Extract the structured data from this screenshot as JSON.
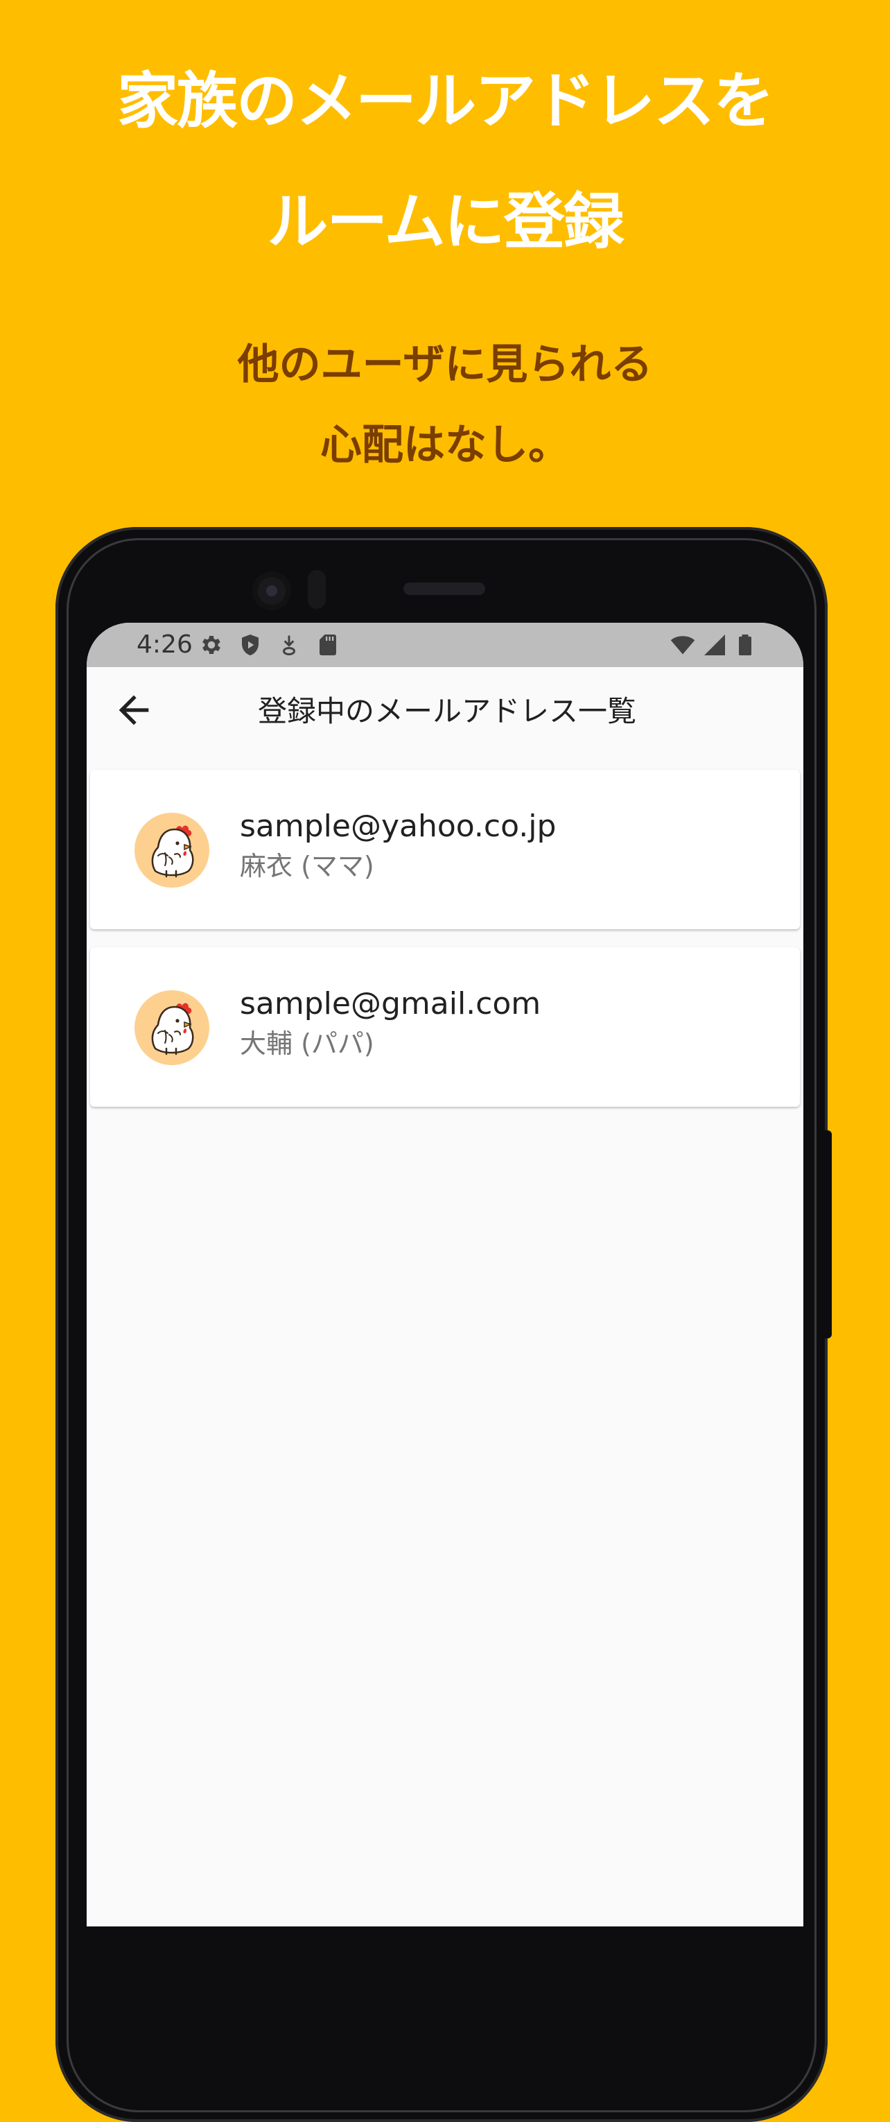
{
  "promo": {
    "headline_line1": "家族のメールアドレスを",
    "headline_line2": "ルームに登録",
    "sub_line1": "他のユーザに見られる",
    "sub_line2": "心配はなし。"
  },
  "status_bar": {
    "time": "4:26",
    "left_icons": [
      "gear-icon",
      "shield-play-icon",
      "download-icon",
      "sd-card-icon"
    ],
    "right_icons": [
      "wifi-icon",
      "cell-signal-icon",
      "battery-icon"
    ]
  },
  "app_bar": {
    "back_icon": "arrow-back-icon",
    "title": "登録中のメールアドレス一覧"
  },
  "emails": [
    {
      "email": "sample@yahoo.co.jp",
      "name": "麻衣 (ママ)",
      "avatar": "chicken-avatar-icon"
    },
    {
      "email": "sample@gmail.com",
      "name": "大輔 (パパ)",
      "avatar": "chicken-avatar-icon"
    }
  ],
  "colors": {
    "background": "#FFBD00",
    "headline": "#FFFFFF",
    "subheadline": "#7A3E00",
    "avatar_bg": "#FDD090",
    "status_bar": "#BDBDBD"
  }
}
